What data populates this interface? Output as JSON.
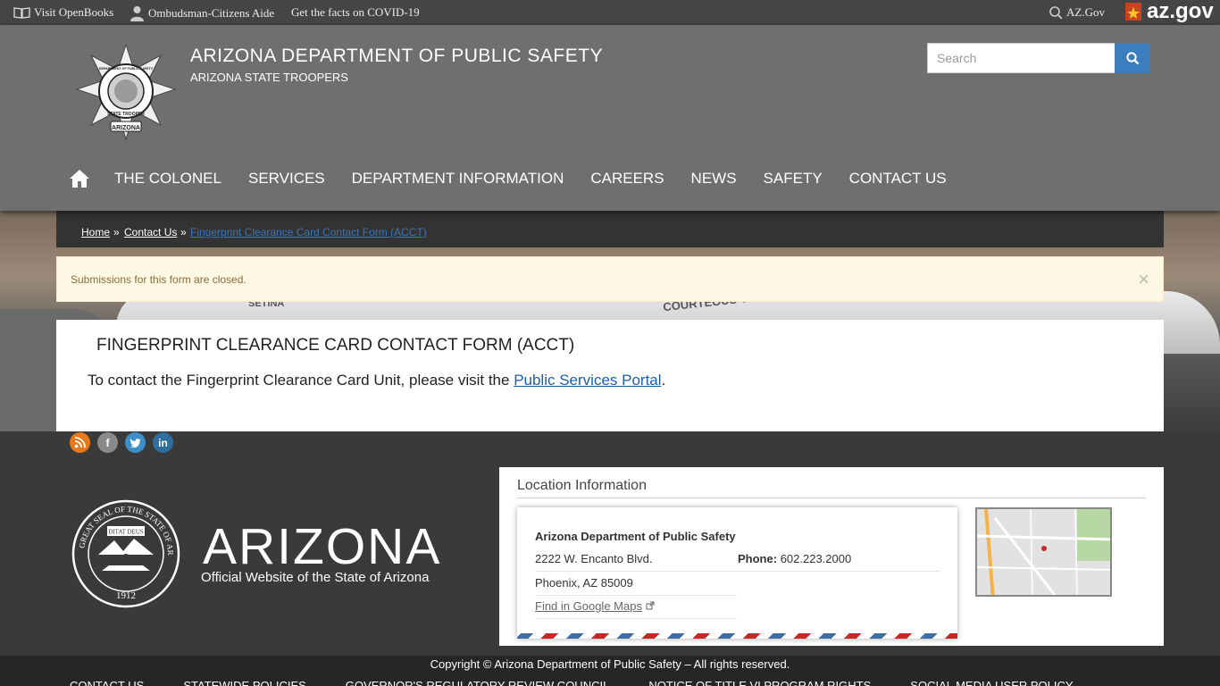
{
  "topbar": {
    "openbooks": "Visit OpenBooks",
    "ombudsman": "Ombudsman-Citizens Aide",
    "covid": "Get the facts on COVID-19",
    "azgov_search": "AZ.Gov",
    "azgov_logo": "az.gov"
  },
  "header": {
    "title": "ARIZONA DEPARTMENT OF PUBLIC SAFETY",
    "subtitle": "ARIZONA STATE TROOPERS",
    "badge_text_top": "DEPARTMENT OF PUBLIC SAFETY",
    "badge_text_bottom": "STATE TROOPER",
    "badge_text_state": "ARIZONA",
    "search_placeholder": "Search"
  },
  "nav": {
    "items": [
      "THE COLONEL",
      "SERVICES",
      "DEPARTMENT INFORMATION",
      "CAREERS",
      "NEWS",
      "SAFETY",
      "CONTACT US"
    ]
  },
  "hero": {
    "car_text1": "SETINA",
    "car_text2": "COURTEOUS VIGILANCE"
  },
  "breadcrumb": {
    "home": "Home",
    "contact": "Contact Us",
    "current": "Fingerprint Clearance Card Contact Form (ACCT)",
    "sep": "»"
  },
  "alert": {
    "message": "Submissions for this form are closed.",
    "close": "×"
  },
  "content": {
    "title": "FINGERPRINT CLEARANCE CARD CONTACT FORM (ACCT)",
    "text_before": "To contact the Fingerprint Clearance Card Unit, please visit the ",
    "link": "Public Services Portal",
    "text_after": "."
  },
  "social": {
    "facebook": "f",
    "linkedin": "in"
  },
  "footer": {
    "state_word": "ARIZONA",
    "state_sub": "Official Website of the State of Arizona",
    "seal_text": "GREAT SEAL OF THE STATE OF ARIZONA",
    "seal_motto": "DITAT DEUS",
    "seal_year": "1912",
    "location_title": "Location Information",
    "org": "Arizona Department of Public Safety",
    "address1": "2222 W. Encanto Blvd.",
    "address2": "Phoenix, AZ 85009",
    "maps_link": "Find in Google Maps",
    "phone_label": "Phone:",
    "phone": "602.223.2000",
    "copyright": "Copyright © Arizona Department of Public Safety – All rights reserved.",
    "links": [
      "CONTACT US",
      "STATEWIDE POLICIES",
      "GOVERNOR'S REGULATORY REVIEW COUNCIL",
      "NOTICE OF TITLE VI PROGRAM RIGHTS",
      "SOCIAL MEDIA USER POLICY"
    ]
  }
}
